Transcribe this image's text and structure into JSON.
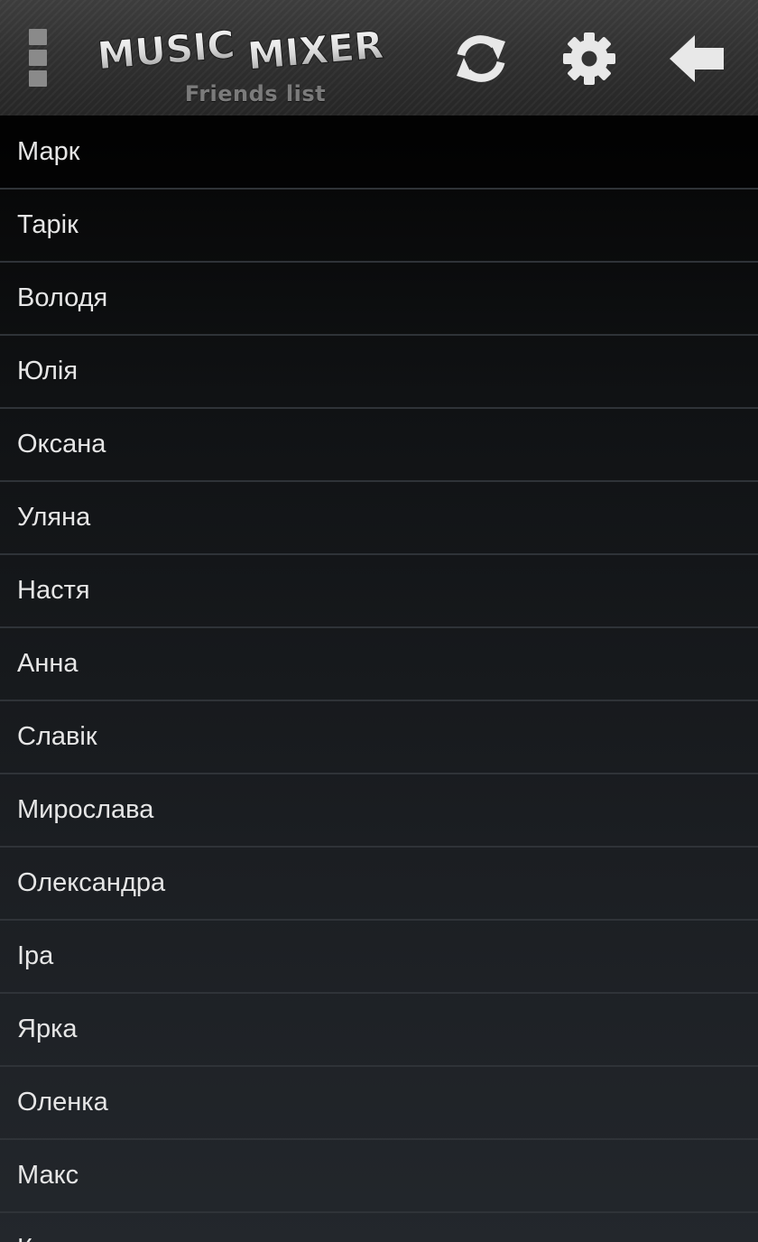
{
  "app": {
    "logo_word_1": "MUSIC",
    "logo_word_2": "MIXER",
    "subtitle": "Friends list"
  },
  "toolbar": {
    "menu_icon": "overflow-menu-icon",
    "refresh_icon": "refresh-icon",
    "settings_icon": "gear-icon",
    "back_icon": "arrow-left-icon"
  },
  "friends": [
    {
      "name": "Марк"
    },
    {
      "name": "Тарік"
    },
    {
      "name": "Володя"
    },
    {
      "name": "Юлія"
    },
    {
      "name": "Оксана"
    },
    {
      "name": "Уляна"
    },
    {
      "name": "Настя"
    },
    {
      "name": "Анна"
    },
    {
      "name": "Славік"
    },
    {
      "name": "Мирослава"
    },
    {
      "name": "Олександра"
    },
    {
      "name": "Іра"
    },
    {
      "name": "Ярка"
    },
    {
      "name": "Оленка"
    },
    {
      "name": "Макс"
    },
    {
      "name": "К"
    }
  ],
  "colors": {
    "actionbar": "#303030",
    "list_background": "#16191c",
    "divider": "#2f3338",
    "text": "#e6e6e6",
    "icon": "#e8e8e8",
    "subtitle": "#7b7b7b"
  }
}
